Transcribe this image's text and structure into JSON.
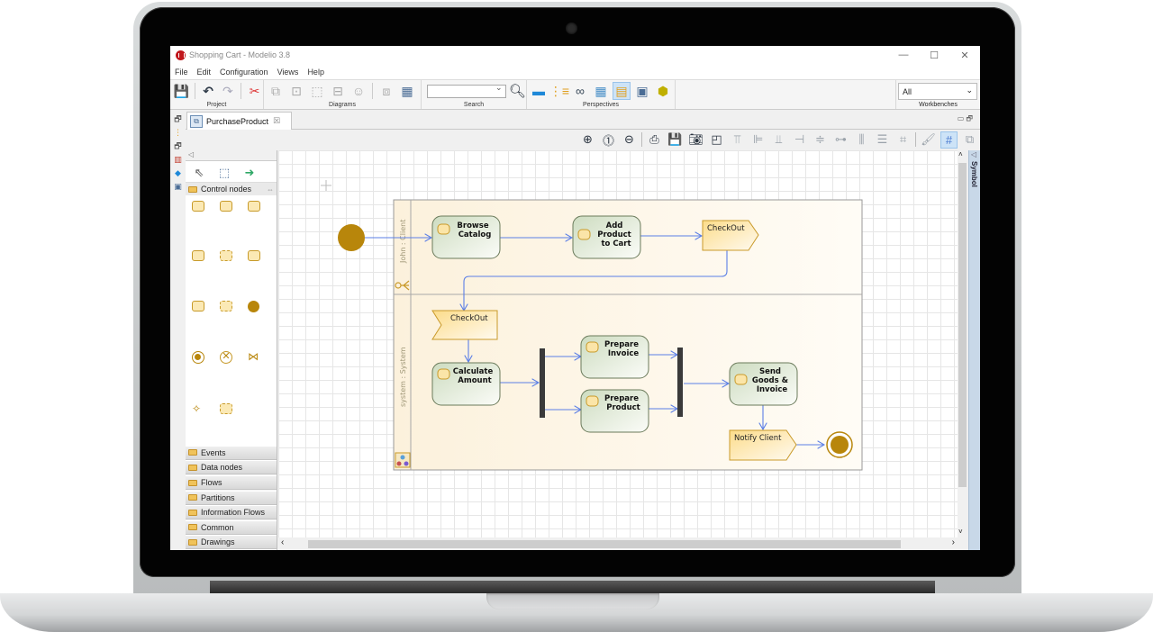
{
  "window": {
    "title": "Shopping Cart - Modelio 3.8",
    "controls": {
      "minimize": "—",
      "maximize": "☐",
      "close": "✕"
    }
  },
  "menu": [
    "File",
    "Edit",
    "Configuration",
    "Views",
    "Help"
  ],
  "toolbar": {
    "groups": [
      {
        "label": "Project",
        "icons": [
          "save-icon",
          "undo-icon",
          "redo-icon",
          "tools-icon"
        ]
      },
      {
        "label": "Diagrams",
        "icons": [
          "class-diagram-icon",
          "package-diagram-icon",
          "activity-diagram-icon",
          "sequence-diagram-icon",
          "usecase-diagram-icon",
          "object-diagram-icon",
          "matrix-icon"
        ]
      },
      {
        "label": "Search",
        "search_value": "",
        "icons": [
          "magnifier-icon"
        ]
      },
      {
        "label": "Perspectives",
        "icons": [
          "project-perspective-icon",
          "model-tree-icon",
          "link-icon",
          "grid-perspective-icon",
          "modeling-perspective-icon",
          "diagram-perspective-icon",
          "hexagon-perspective-icon"
        ],
        "selected_index": 4
      },
      {
        "label": "Workbenches",
        "selected": "All"
      }
    ]
  },
  "editor": {
    "tab": {
      "label": "PurchaseProduct",
      "close": "☒"
    },
    "view_controls": "▭ 🗗"
  },
  "diagram_toolbar": {
    "icons": [
      "zoom-in-icon",
      "zoom-fit-icon",
      "zoom-out-icon",
      "print-icon",
      "save-image-icon",
      "camera-icon",
      "select-area-icon",
      "align-top-icon",
      "align-left-icon",
      "align-bottom-icon",
      "align-right-icon",
      "align-center-icon",
      "align-middle-icon",
      "distribute-h-icon",
      "distribute-v-icon",
      "grid-snap-icon",
      "format-painter-icon",
      "grid-icon",
      "layer-icon"
    ],
    "selected": "grid-icon"
  },
  "palette": {
    "collapse": "◁",
    "tools": [
      "select-tool-icon",
      "marquee-select-tool-icon",
      "connector-tool-icon"
    ],
    "open_section": "Control nodes",
    "sections": [
      "Events",
      "Data nodes",
      "Flows",
      "Partitions",
      "Information Flows",
      "Common",
      "Drawings"
    ]
  },
  "right_panel": {
    "label": "Symbol",
    "arrow": "◁"
  },
  "diagram": {
    "name": "PurchaseProduct",
    "partitions": [
      {
        "name": "John : Client"
      },
      {
        "name": "system : System"
      }
    ],
    "actions": {
      "browse_catalog": [
        "Browse",
        "Catalog"
      ],
      "add_product": [
        "Add",
        "Product",
        "to Cart"
      ],
      "calculate_amount": [
        "Calculate",
        "Amount"
      ],
      "prepare_invoice": [
        "Prepare",
        "Invoice"
      ],
      "prepare_product": [
        "Prepare",
        "Product"
      ],
      "send_goods": [
        "Send",
        "Goods &",
        "Invoice"
      ]
    },
    "signals": {
      "send_checkout": "CheckOut",
      "accept_checkout": "CheckOut",
      "notify_client": "Notify Client"
    },
    "colors": {
      "initial_node": "#b8860b",
      "action_fill_top": "#d7e3cc",
      "signal_fill": "#fde7a6",
      "flow": "#5b7fe6",
      "partition_fill": "#fdf6e6"
    }
  },
  "scroll": {
    "left": "‹",
    "right": "›",
    "up": "˄",
    "down": "˅"
  }
}
